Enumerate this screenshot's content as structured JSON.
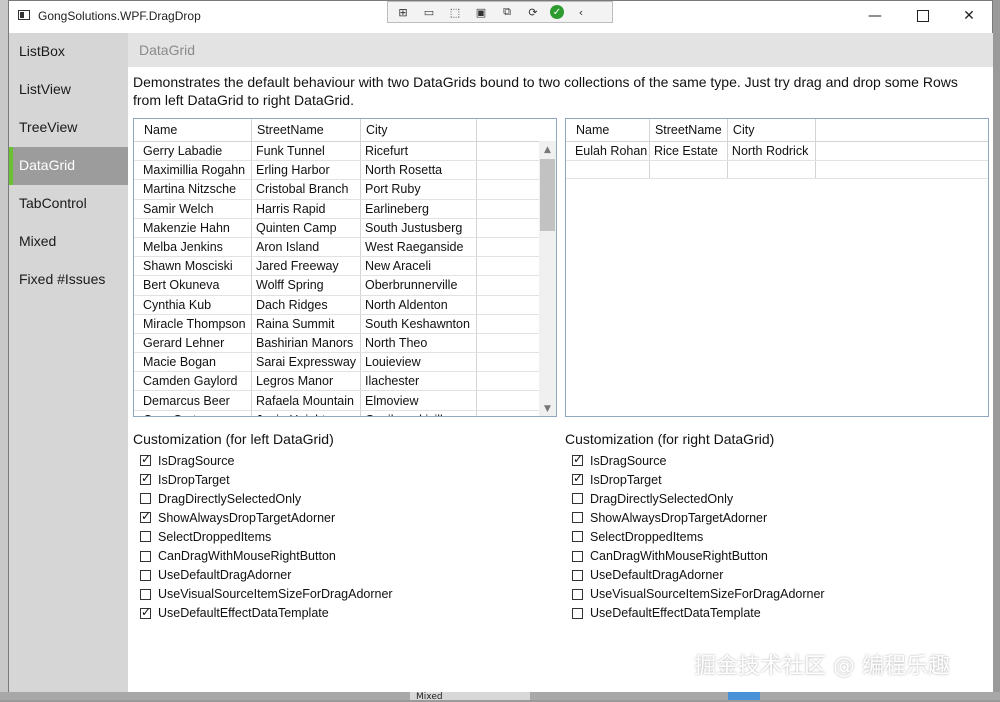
{
  "window": {
    "title": "GongSolutions.WPF.DragDrop"
  },
  "debug_toolbar": {
    "items": [
      "select-element-icon",
      "record-icon",
      "pointer-icon",
      "track-focus-icon",
      "layout-icon",
      "refresh-icon",
      "check-icon",
      "collapse-icon"
    ]
  },
  "window_controls": {
    "minimize": "—",
    "close": "✕"
  },
  "sidebar": {
    "items": [
      {
        "label": "ListBox"
      },
      {
        "label": "ListView"
      },
      {
        "label": "TreeView"
      },
      {
        "label": "DataGrid"
      },
      {
        "label": "TabControl"
      },
      {
        "label": "Mixed"
      },
      {
        "label": "Fixed #Issues"
      }
    ],
    "active_index": 3,
    "accent_color": "#6ac232"
  },
  "page": {
    "title": "DataGrid",
    "description": "Demonstrates the default behaviour with two DataGrids bound to two collections of the same type. Just try drag and drop some Rows from left DataGrid to right DataGrid."
  },
  "left_grid": {
    "columns": [
      "Name",
      "StreetName",
      "City"
    ],
    "rows": [
      [
        "Gerry Labadie",
        "Funk Tunnel",
        "Ricefurt"
      ],
      [
        "Maximillia Rogahn",
        "Erling Harbor",
        "North Rosetta"
      ],
      [
        "Martina Nitzsche",
        "Cristobal Branch",
        "Port Ruby"
      ],
      [
        "Samir Welch",
        "Harris Rapid",
        "Earlineberg"
      ],
      [
        "Makenzie Hahn",
        "Quinten Camp",
        "South Justusberg"
      ],
      [
        "Melba Jenkins",
        "Aron Island",
        "West Raeganside"
      ],
      [
        "Shawn Mosciski",
        "Jared Freeway",
        "New Araceli"
      ],
      [
        "Bert Okuneva",
        "Wolff Spring",
        "Oberbrunnerville"
      ],
      [
        "Cynthia Kub",
        "Dach Ridges",
        "North Aldenton"
      ],
      [
        "Miracle Thompson",
        "Raina Summit",
        "South Keshawnton"
      ],
      [
        "Gerard Lehner",
        "Bashirian Manors",
        "North Theo"
      ],
      [
        "Macie Bogan",
        "Sarai Expressway",
        "Louieview"
      ],
      [
        "Camden Gaylord",
        "Legros Manor",
        "Ilachester"
      ],
      [
        "Demarcus Beer",
        "Rafaela Mountain",
        "Elmoview"
      ],
      [
        "Cory Carter",
        "Janie Heights",
        "Gusikowskiville"
      ]
    ]
  },
  "right_grid": {
    "columns": [
      "Name",
      "StreetName",
      "City"
    ],
    "rows": [
      [
        "Eulah Rohan",
        "Rice Estate",
        "North Rodrick"
      ]
    ]
  },
  "left_customization": {
    "title": "Customization (for left DataGrid)",
    "options": [
      {
        "label": "IsDragSource",
        "checked": true
      },
      {
        "label": "IsDropTarget",
        "checked": true
      },
      {
        "label": "DragDirectlySelectedOnly",
        "checked": false
      },
      {
        "label": "ShowAlwaysDropTargetAdorner",
        "checked": true
      },
      {
        "label": "SelectDroppedItems",
        "checked": false
      },
      {
        "label": "CanDragWithMouseRightButton",
        "checked": false
      },
      {
        "label": "UseDefaultDragAdorner",
        "checked": false
      },
      {
        "label": "UseVisualSourceItemSizeForDragAdorner",
        "checked": false
      },
      {
        "label": "UseDefaultEffectDataTemplate",
        "checked": true
      }
    ]
  },
  "right_customization": {
    "title": "Customization (for right DataGrid)",
    "options": [
      {
        "label": "IsDragSource",
        "checked": true
      },
      {
        "label": "IsDropTarget",
        "checked": true
      },
      {
        "label": "DragDirectlySelectedOnly",
        "checked": false
      },
      {
        "label": "ShowAlwaysDropTargetAdorner",
        "checked": false
      },
      {
        "label": "SelectDroppedItems",
        "checked": false
      },
      {
        "label": "CanDragWithMouseRightButton",
        "checked": false
      },
      {
        "label": "UseDefaultDragAdorner",
        "checked": false
      },
      {
        "label": "UseVisualSourceItemSizeForDragAdorner",
        "checked": false
      },
      {
        "label": "UseDefaultEffectDataTemplate",
        "checked": false
      }
    ]
  },
  "watermark": "掘金技术社区 @ 编程乐趣",
  "background_label": "Mixed"
}
